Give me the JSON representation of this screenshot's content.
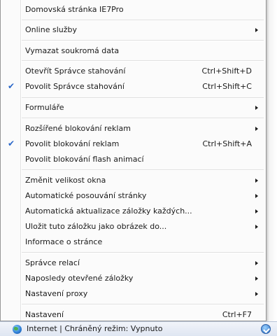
{
  "menu": {
    "items": [
      {
        "label": "Domovská stránka IE7Pro"
      },
      {
        "label": "Online služby",
        "submenu": true
      },
      {
        "label": "Vymazat soukromá data"
      },
      {
        "label": "Otevřít Správce stahování",
        "shortcut": "Ctrl+Shift+D"
      },
      {
        "label": "Povolit Správce stahování",
        "shortcut": "Ctrl+Shift+C",
        "checked": true
      },
      {
        "label": "Formuláře",
        "submenu": true
      },
      {
        "label": "Rozšířené blokování reklam",
        "submenu": true
      },
      {
        "label": "Povolit blokování reklam",
        "shortcut": "Ctrl+Shift+A",
        "checked": true
      },
      {
        "label": "Povolit blokování flash animací"
      },
      {
        "label": "Změnit velikost okna",
        "submenu": true
      },
      {
        "label": "Automatické posouvání stránky",
        "submenu": true
      },
      {
        "label": "Automatická aktualizace záložky každých...",
        "submenu": true
      },
      {
        "label": "Uložit tuto záložku jako obrázek do...",
        "submenu": true
      },
      {
        "label": "Informace o stránce"
      },
      {
        "label": "Správce relací",
        "submenu": true
      },
      {
        "label": "Naposledy otevřené záložky",
        "submenu": true
      },
      {
        "label": "Nastavení proxy",
        "submenu": true
      },
      {
        "label": "Nastavení",
        "shortcut": "Ctrl+F7"
      }
    ],
    "check_glyph": "✔"
  },
  "statusbar": {
    "text": "Internet | Chráněný režim: Vypnuto"
  }
}
